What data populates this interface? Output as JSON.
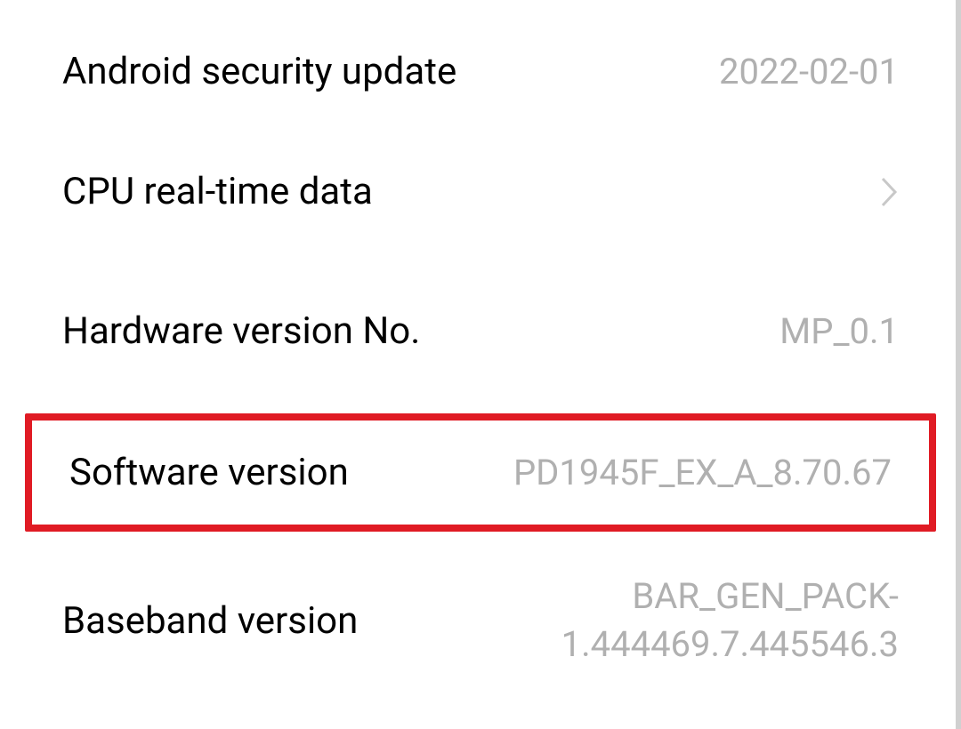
{
  "rows": {
    "security_update": {
      "label": "Android security update",
      "value": "2022-02-01"
    },
    "cpu_data": {
      "label": "CPU real-time data"
    },
    "hardware_version": {
      "label": "Hardware version No.",
      "value": "MP_0.1"
    },
    "software_version": {
      "label": "Software version",
      "value": "PD1945F_EX_A_8.70.67"
    },
    "baseband_version": {
      "label": "Baseband version",
      "value": "BAR_GEN_PACK-1.444469.7.445546.3"
    }
  }
}
